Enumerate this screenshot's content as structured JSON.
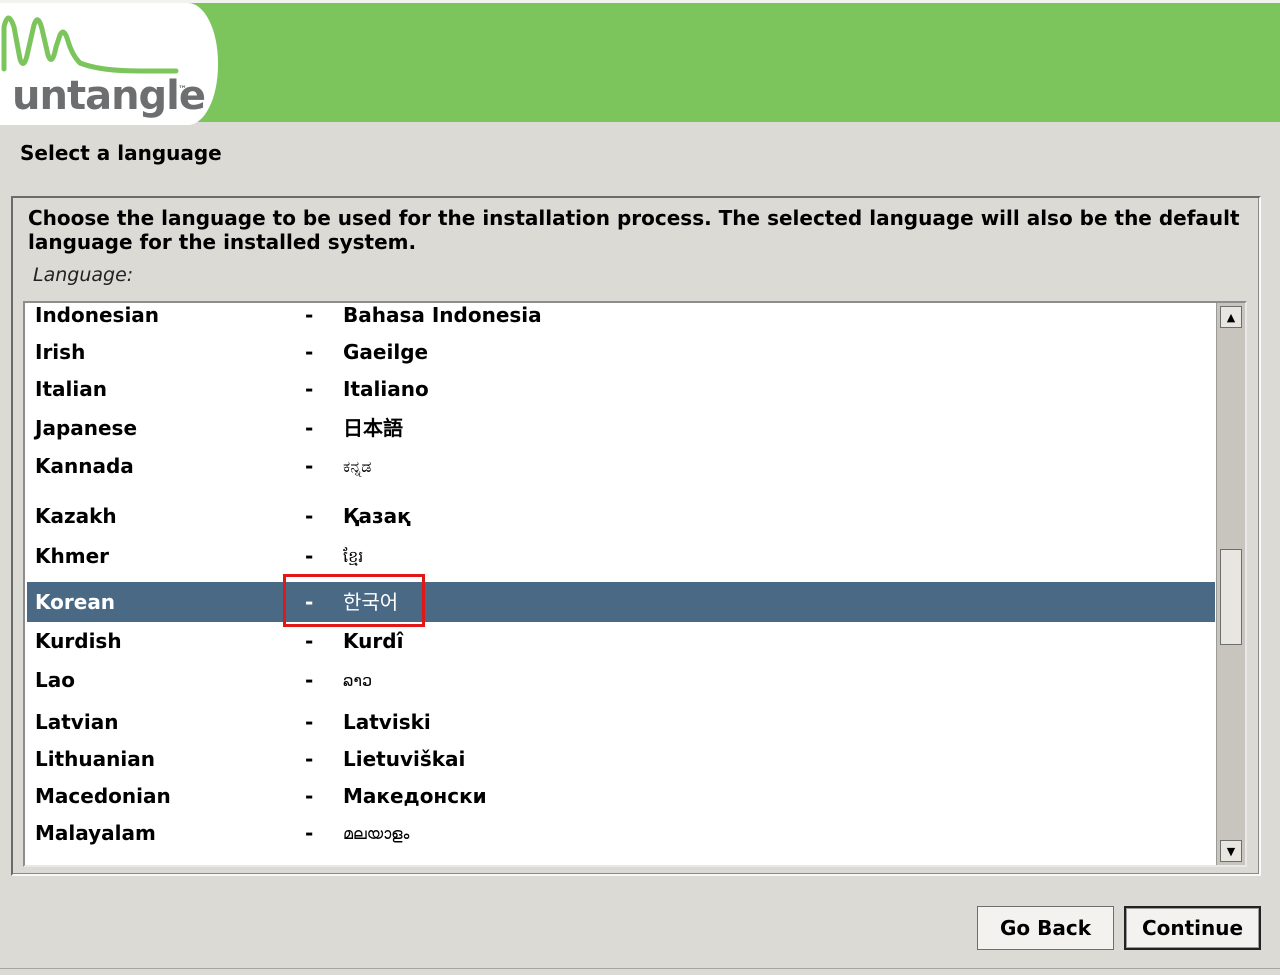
{
  "brand": {
    "logo_text": "untangle",
    "trademark": "™",
    "header_color": "#7cc55c"
  },
  "page": {
    "title": "Select a language",
    "description": "Choose the language to be used for the installation process. The selected language will also be the default language for the installed system.",
    "list_label": "Language:"
  },
  "languages": [
    {
      "name": "Indonesian",
      "dash": "-",
      "native": "Bahasa Indonesia"
    },
    {
      "name": "Irish",
      "dash": "-",
      "native": "Gaeilge"
    },
    {
      "name": "Italian",
      "dash": "-",
      "native": "Italiano"
    },
    {
      "name": "Japanese",
      "dash": "-",
      "native": "日本語"
    },
    {
      "name": "Kannada",
      "dash": "-",
      "native": "ಕನ್ನಡ"
    },
    {
      "name": "Kazakh",
      "dash": "-",
      "native": "Қазақ"
    },
    {
      "name": "Khmer",
      "dash": "-",
      "native": "ខ្មែរ"
    },
    {
      "name": "Korean",
      "dash": "-",
      "native": "한국어",
      "selected": true
    },
    {
      "name": "Kurdish",
      "dash": "-",
      "native": "Kurdî"
    },
    {
      "name": "Lao",
      "dash": "-",
      "native": "ລາວ"
    },
    {
      "name": "Latvian",
      "dash": "-",
      "native": "Latviski"
    },
    {
      "name": "Lithuanian",
      "dash": "-",
      "native": "Lietuviškai"
    },
    {
      "name": "Macedonian",
      "dash": "-",
      "native": "Македонски"
    },
    {
      "name": "Malayalam",
      "dash": "-",
      "native": "മലയാളം"
    }
  ],
  "scrollbar": {
    "up_icon": "▲",
    "down_icon": "▼"
  },
  "buttons": {
    "go_back": "Go Back",
    "continue": "Continue"
  },
  "colors": {
    "selection": "#4a6984",
    "highlight_box": "#e01818"
  }
}
